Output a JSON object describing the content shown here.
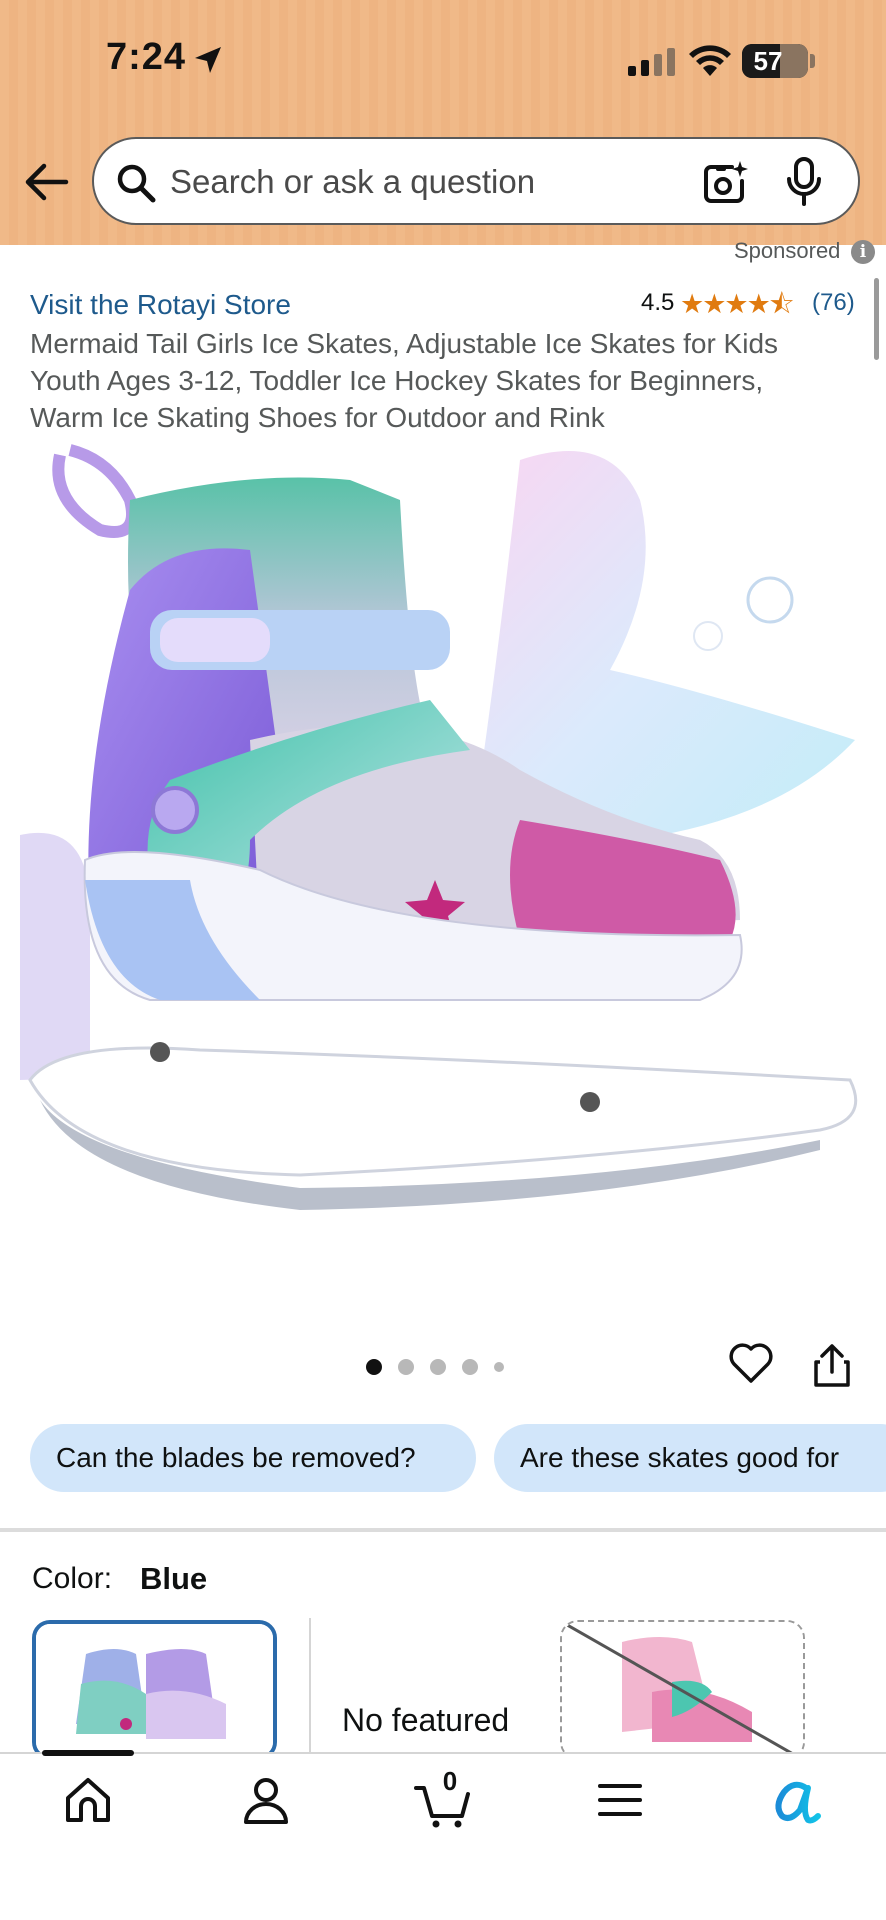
{
  "status_bar": {
    "time": "7:24",
    "battery_level": "57",
    "battery_fraction": 0.57
  },
  "header": {
    "search_placeholder": "Search or ask a question"
  },
  "product": {
    "sponsored_label": "Sponsored",
    "store_link": "Visit the Rotayi Store",
    "rating": "4.5",
    "stars": "★★★★⯪",
    "rating_count": "(76)",
    "title": "Mermaid Tail Girls Ice Skates, Adjustable Ice Skates for Kids Youth Ages 3-12, Toddler Ice Hockey Skates for Beginners, Warm Ice Skating Shoes for Outdoor and Rink",
    "image_count": 5,
    "active_image": 1
  },
  "questions": [
    "Can the blades be removed?",
    "Are these skates good for"
  ],
  "color": {
    "label": "Color:",
    "value": "Blue",
    "no_offers_text": "No featured"
  },
  "bottom_nav": {
    "items": [
      "home-icon",
      "account-icon",
      "cart-icon",
      "menu-icon",
      "rufus-icon"
    ],
    "cart_count": "0"
  },
  "colors": {
    "header_bg": "#f0b988",
    "link": "#1e5a8c",
    "star": "#e07b10",
    "chip_bg": "#d2e6fa",
    "swatch_selected_border": "#2b6bab"
  }
}
